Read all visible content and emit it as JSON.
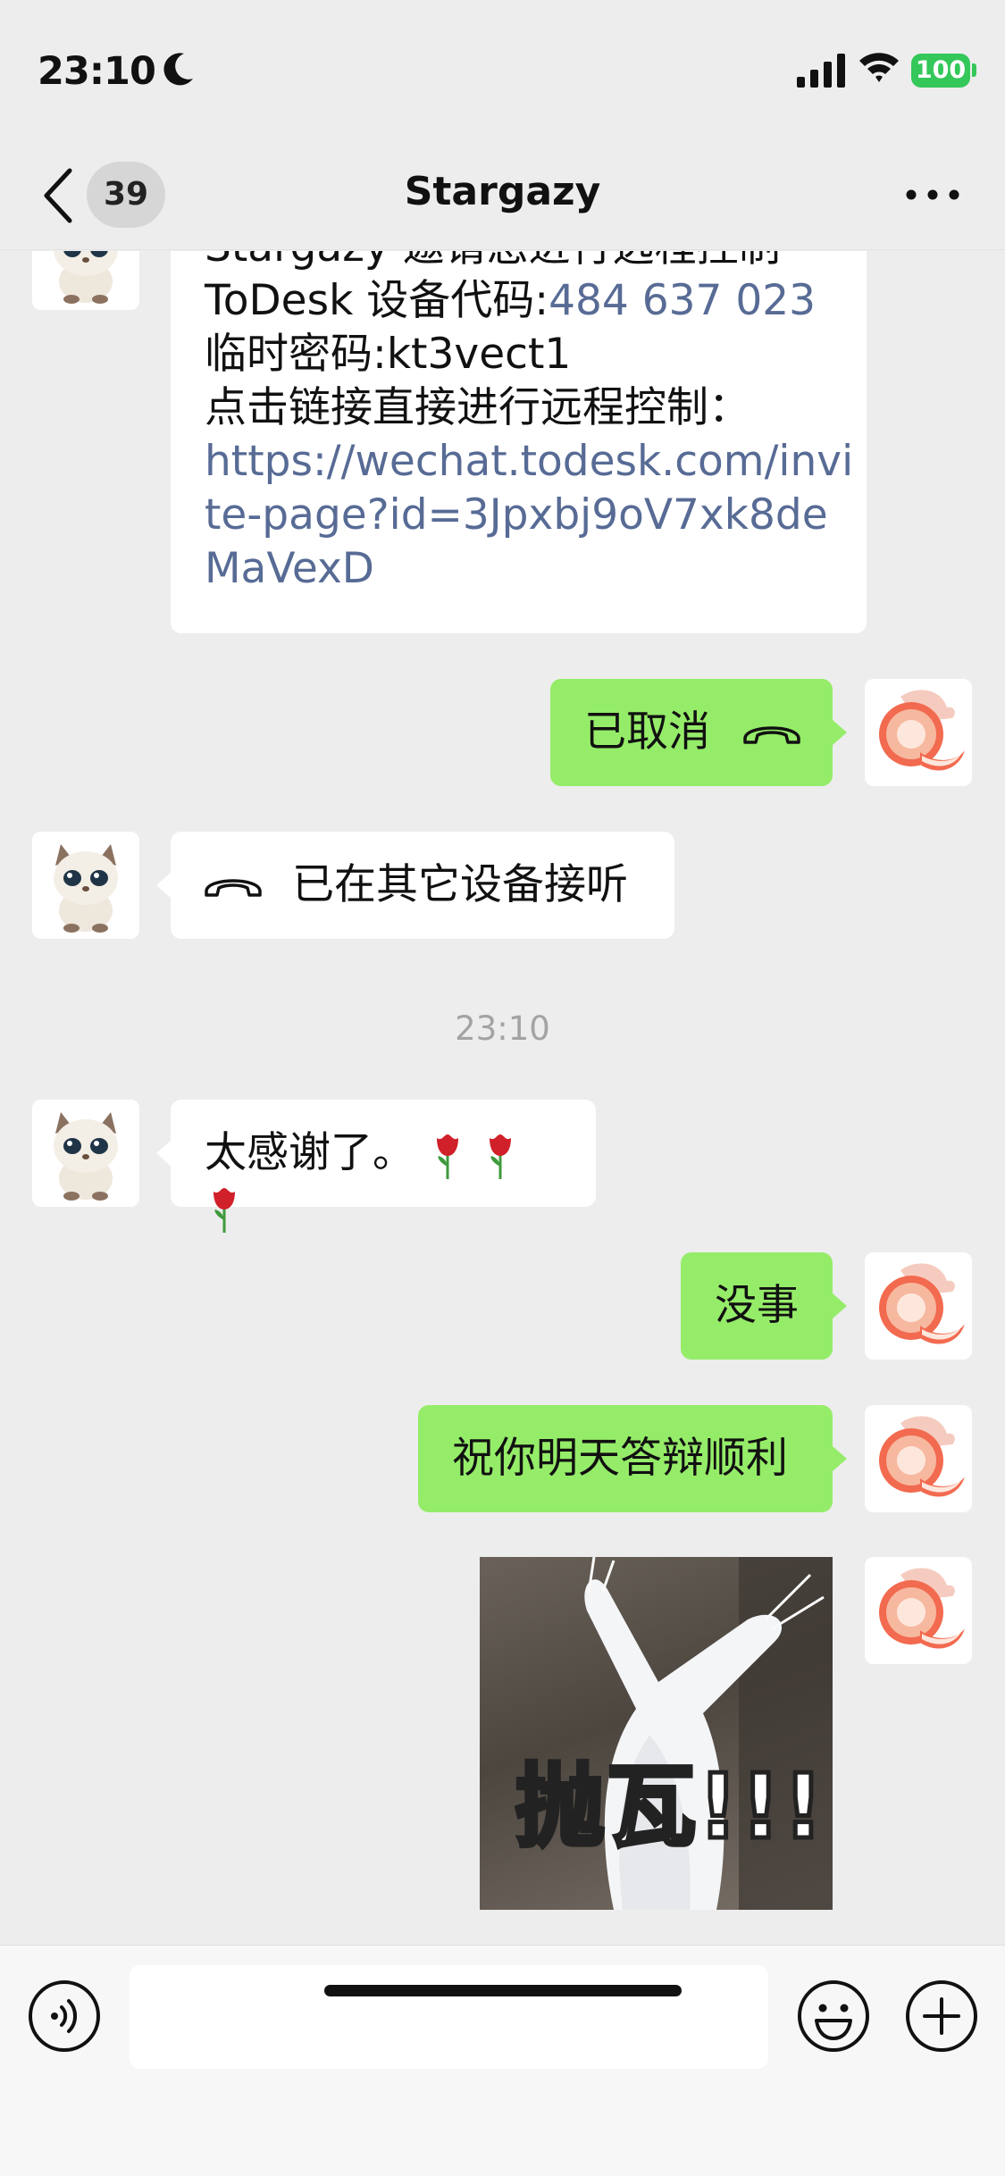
{
  "status_bar": {
    "time": "23:10",
    "battery": "100",
    "icons": [
      "moon-icon",
      "signal-icon",
      "wifi-icon",
      "battery-icon"
    ],
    "battery_color": "#34c759"
  },
  "nav": {
    "unread_count": "39",
    "title": "Stargazy",
    "icons": [
      "back-icon",
      "more-icon"
    ]
  },
  "messages": {
    "todesk": {
      "line1": "Stargazy 邀请您进行远程控制",
      "line2_prefix": "ToDesk 设备代码:",
      "device_code": "484 637 023",
      "line3": "临时密码:kt3vect1",
      "line4": "点击链接直接进行远程控制：",
      "link_line1": "https://wechat.todesk.com/invi",
      "link_line2": "te-page?id=3Jpxbj9oV7xk8de",
      "link_line3": "MaVexD"
    },
    "call_cancelled": "已取消",
    "answered_elsewhere": "已在其它设备接听",
    "timestamp": "23:10",
    "thanks": "太感谢了。",
    "no_problem": "没事",
    "good_luck": "祝你明天答辩顺利",
    "sticker_text": "抛瓦!!!"
  },
  "colors": {
    "background": "#ededed",
    "outgoing_bubble": "#95ec69",
    "incoming_bubble": "#ffffff",
    "link": "#576b95"
  },
  "input_bar": {
    "icons": [
      "voice-icon",
      "emoji-icon",
      "plus-icon"
    ]
  }
}
